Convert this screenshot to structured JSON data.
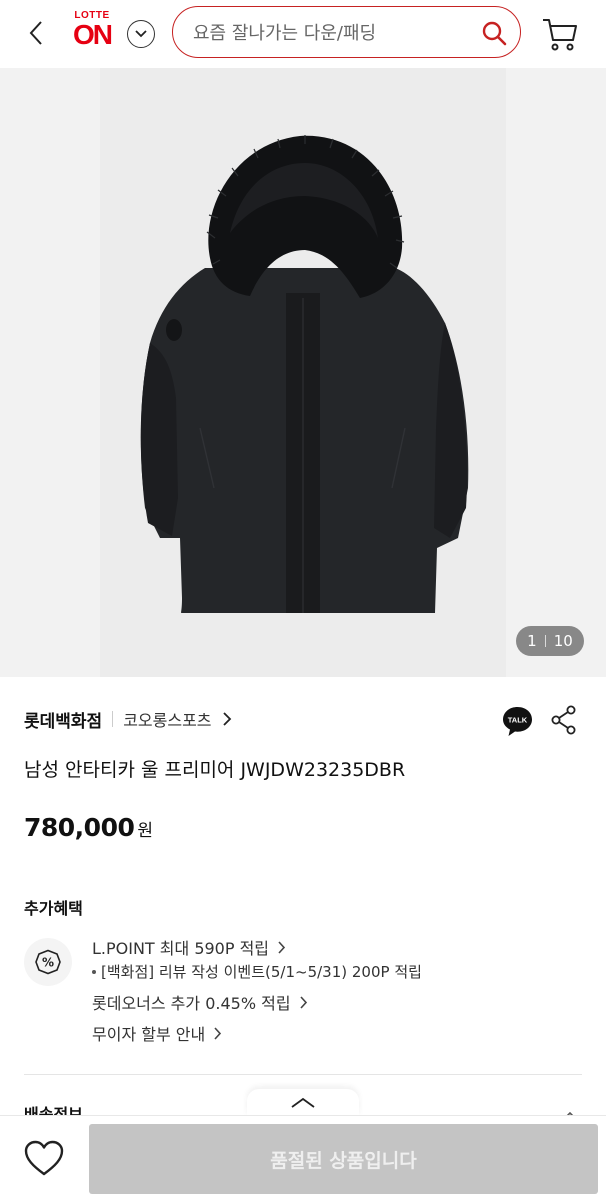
{
  "header": {
    "logo_top": "LOTTE",
    "logo_main": "ON",
    "search_placeholder": "요즘 잘나가는 다운/패딩"
  },
  "hero": {
    "current_page": "1",
    "total_pages": "10"
  },
  "product": {
    "brand": "롯데백화점",
    "sub_brand": "코오롱스포츠",
    "talk_label": "TALK",
    "title": "남성 안타티카 울 프리미어 JWJDW23235DBR",
    "price": "780,000",
    "price_unit": "원"
  },
  "benefits": {
    "section_title": "추가혜택",
    "icon_glyph": "%",
    "lines": [
      "L.POINT 최대 590P 적립",
      "[백화점] 리뷰 작성 이벤트(5/1~5/31) 200P 적립",
      "롯데오너스 추가 0.45% 적립",
      "무이자 할부 안내"
    ]
  },
  "next_section": {
    "title": "배송정보"
  },
  "bottom_bar": {
    "soldout_label": "품절된 상품입니다"
  },
  "colors": {
    "brand_red": "#e60012",
    "search_border": "#c62222",
    "soldout_bg": "#c4c4c4"
  }
}
